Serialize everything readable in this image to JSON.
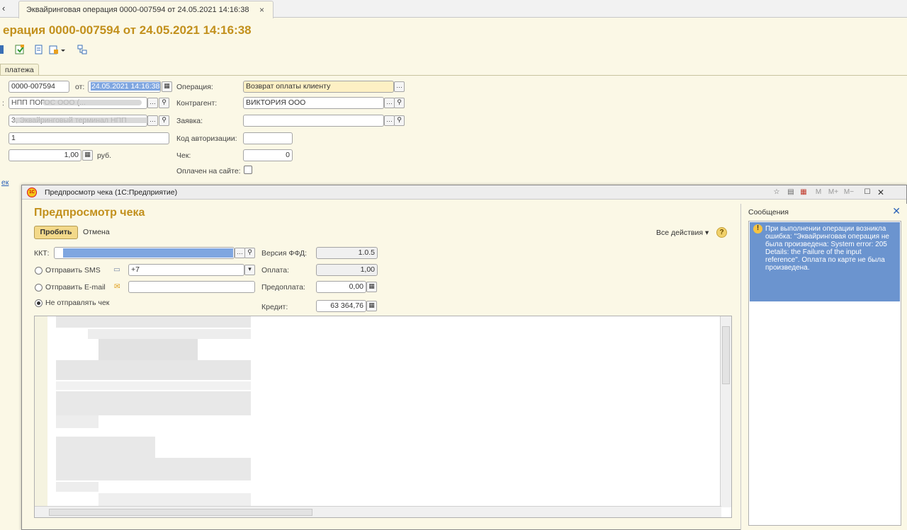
{
  "tabbar": {
    "doc_tab_label": "Эквайринговая операция 0000-007594 от 24.05.2021 14:16:38",
    "close_glyph": "×",
    "back_glyph": "‹"
  },
  "document": {
    "title": "ерация 0000-007594 от 24.05.2021 14:16:38",
    "subtab": "платежа",
    "number": "0000-007594",
    "from_label": "от:",
    "date": "24.05.2021 14:16:38",
    "operation_label": "Операция:",
    "operation_value": "Возврат оплаты клиенту",
    "counterparty_label": "Контрагент:",
    "counterparty_value": "ВИКТОРИЯ ООО",
    "request_label": "Заявка:",
    "request_value": "",
    "auth_code_label": "Код авторизации:",
    "auth_code_value": "",
    "check_label": "Чек:",
    "check_value": "0",
    "paid_site_label": "Оплачен на сайте:",
    "field_org_prefix": ":",
    "field_org_value": "НПП ПОГОС ООО (...",
    "field_terminal_value": "3, Эквайринговый терминал НПП",
    "field_one_value": "1",
    "amount_value": "1,00",
    "currency": "руб.",
    "side_link": "ек"
  },
  "modal": {
    "window_title": "Предпросмотр чека  (1С:Предприятие)",
    "heading": "Предпросмотр чека",
    "primary_button": "Пробить",
    "cancel_button": "Отмена",
    "all_actions": "Все действия ▾",
    "kkt_label": "ККТ:",
    "ffd_label": "Версия ФФД:",
    "ffd_value": "1.0.5",
    "sms_label": "Отправить SMS",
    "sms_value": "+7",
    "payment_label": "Оплата:",
    "payment_value": "1,00",
    "email_label": "Отправить E-mail",
    "email_value": "",
    "prepay_label": "Предоплата:",
    "prepay_value": "0,00",
    "no_send_label": "Не отправлять чек",
    "credit_label": "Кредит:",
    "credit_value": "63 364,76",
    "window_buttons": [
      "M",
      "M+",
      "M−"
    ],
    "messages": {
      "title": "Сообщения",
      "text": "При выполнении операции возникла ошибка: \"Эквайринговая операция не была произведена: System error: 205 Details: the Failure of the input reference\". Оплата по карте не была произведена."
    }
  }
}
